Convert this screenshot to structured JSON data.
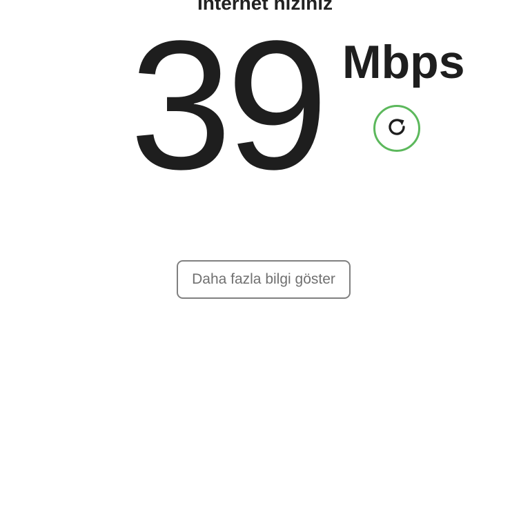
{
  "header": {
    "title": "İnternet hızınız"
  },
  "speed": {
    "value": "39",
    "unit": "Mbps"
  },
  "refresh": {
    "icon": "refresh-icon",
    "accent_color": "#5cb85c"
  },
  "actions": {
    "more_info_label": "Daha fazla bilgi göster"
  }
}
